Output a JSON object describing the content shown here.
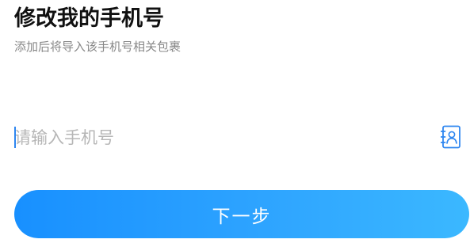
{
  "header": {
    "title": "修改我的手机号",
    "subtitle": "添加后将导入该手机号相关包裹"
  },
  "phone_field": {
    "value": "",
    "placeholder": "请输入手机号",
    "contact_icon": "contact-book-icon"
  },
  "actions": {
    "next_label": "下一步"
  },
  "colors": {
    "title": "#111111",
    "subtitle": "#888888",
    "placeholder": "#b6b6b6",
    "accent": "#2e86f0",
    "button_gradient_start": "#1890ff",
    "button_gradient_end": "#3bb8ff",
    "button_text": "#ffffff"
  }
}
